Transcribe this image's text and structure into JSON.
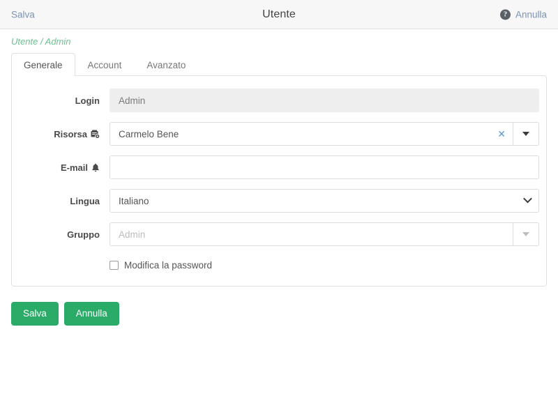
{
  "header": {
    "save_label": "Salva",
    "title": "Utente",
    "cancel_label": "Annulla",
    "help_glyph": "?"
  },
  "breadcrumb": {
    "text": "Utente / Admin"
  },
  "tabs": [
    {
      "label": "Generale",
      "active": true
    },
    {
      "label": "Account",
      "active": false
    },
    {
      "label": "Avanzato",
      "active": false
    }
  ],
  "form": {
    "login": {
      "label": "Login",
      "value": "Admin",
      "readonly": true
    },
    "risorsa": {
      "label": "Risorsa",
      "icon": "resource-badge-icon",
      "value": "Carmelo Bene",
      "clear_glyph": "✕",
      "dropdown_icon": "caret-down-icon"
    },
    "email": {
      "label": "E-mail",
      "icon": "bell-icon",
      "value": "",
      "placeholder": ""
    },
    "lingua": {
      "label": "Lingua",
      "value": "Italiano",
      "options": [
        "Italiano"
      ],
      "dropdown_icon": "chevron-down-icon"
    },
    "gruppo": {
      "label": "Gruppo",
      "value": "Admin",
      "muted": true,
      "dropdown_icon": "caret-down-icon"
    },
    "modifica_password": {
      "label": "Modifica la password",
      "checked": false
    }
  },
  "footer": {
    "save_label": "Salva",
    "cancel_label": "Annulla"
  },
  "colors": {
    "accent_green": "#2aab68",
    "breadcrumb_green": "#6cbf8f",
    "link_blue": "#7b93b5",
    "clear_blue": "#5b9bd5"
  }
}
